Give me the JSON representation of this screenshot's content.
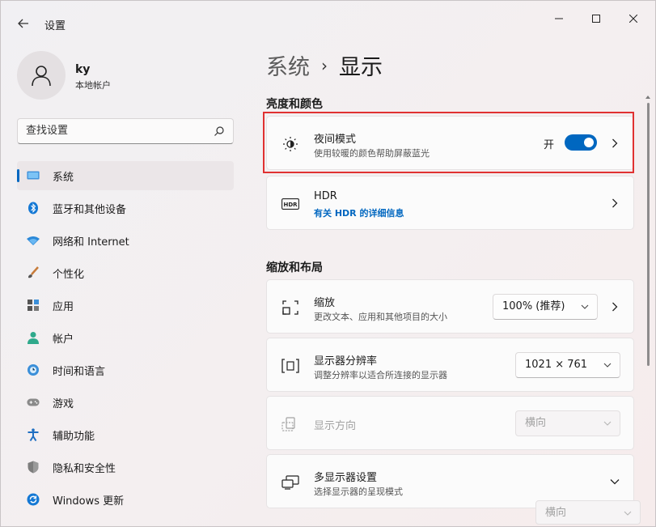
{
  "titlebar": {
    "title": "设置"
  },
  "profile": {
    "name": "ky",
    "account_type": "本地帐户"
  },
  "search": {
    "placeholder": "查找设置"
  },
  "sidebar": {
    "items": [
      {
        "label": "系统",
        "icon": "monitor-icon",
        "active": true
      },
      {
        "label": "蓝牙和其他设备",
        "icon": "bluetooth-icon"
      },
      {
        "label": "网络和 Internet",
        "icon": "wifi-icon"
      },
      {
        "label": "个性化",
        "icon": "brush-icon"
      },
      {
        "label": "应用",
        "icon": "apps-icon"
      },
      {
        "label": "帐户",
        "icon": "person-icon"
      },
      {
        "label": "时间和语言",
        "icon": "globe-clock-icon"
      },
      {
        "label": "游戏",
        "icon": "gamepad-icon"
      },
      {
        "label": "辅助功能",
        "icon": "accessibility-icon"
      },
      {
        "label": "隐私和安全性",
        "icon": "shield-icon"
      },
      {
        "label": "Windows 更新",
        "icon": "update-icon"
      }
    ]
  },
  "main": {
    "breadcrumb": {
      "parent": "系统",
      "separator": "›",
      "current": "显示"
    },
    "section_brightness": "亮度和颜色",
    "night_light": {
      "title": "夜间模式",
      "subtitle": "使用较暖的颜色帮助屏蔽蓝光",
      "toggle_label": "开"
    },
    "hdr": {
      "title": "HDR",
      "link": "有关 HDR 的详细信息"
    },
    "section_scale": "缩放和布局",
    "scale": {
      "title": "缩放",
      "subtitle": "更改文本、应用和其他项目的大小",
      "value": "100% (推荐)"
    },
    "resolution": {
      "title": "显示器分辨率",
      "subtitle": "调整分辨率以适合所连接的显示器",
      "value": "1021 × 761"
    },
    "orientation": {
      "title": "显示方向",
      "value": "横向"
    },
    "multi_display": {
      "title": "多显示器设置",
      "subtitle": "选择显示器的呈现模式",
      "value": "横向"
    }
  },
  "colors": {
    "accent": "#0067c0",
    "highlight": "#e03131"
  }
}
